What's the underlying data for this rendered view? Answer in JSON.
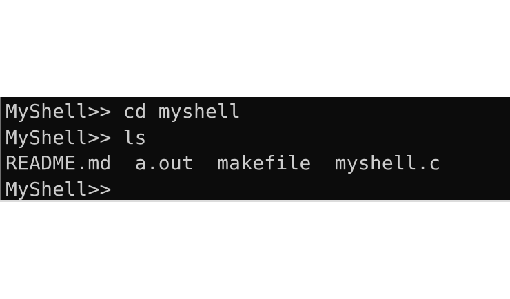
{
  "terminal": {
    "background": "#0c0c0c",
    "text_color": "#cccccc",
    "lines": [
      {
        "prompt": "MyShell>>",
        "command": "cd myshell"
      },
      {
        "prompt": "MyShell>>",
        "command": "ls"
      }
    ],
    "ls_output": [
      "README.md",
      "a.out",
      "makefile",
      "myshell.c"
    ],
    "current_prompt": "MyShell>>"
  }
}
